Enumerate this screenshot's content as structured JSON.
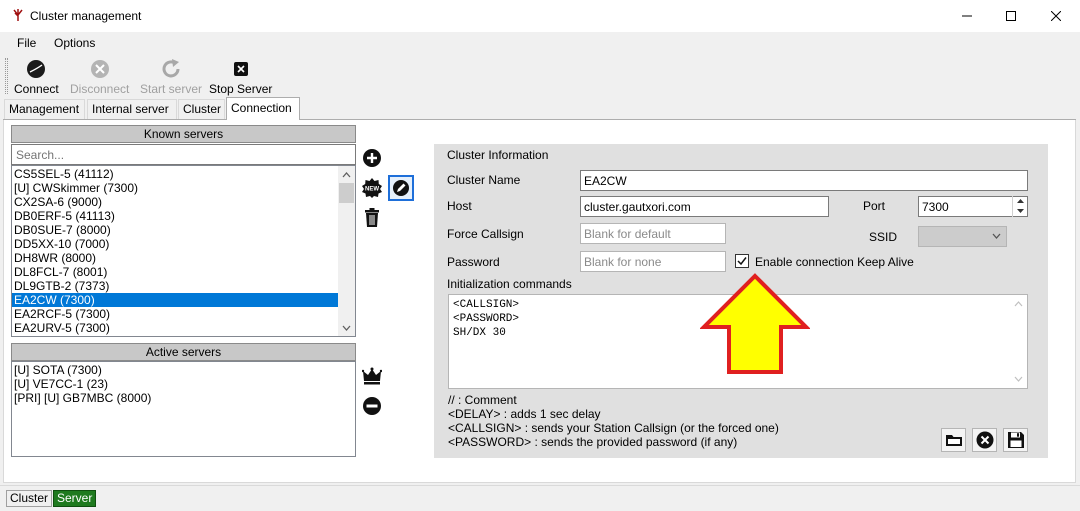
{
  "window": {
    "title": "Cluster management"
  },
  "menu": {
    "file": "File",
    "options": "Options"
  },
  "toolbar": {
    "connect": "Connect",
    "disconnect": "Disconnect",
    "start_server": "Start server",
    "stop_server": "Stop Server"
  },
  "tabs": [
    "Management",
    "Internal server",
    "Cluster",
    "Connection"
  ],
  "active_tab": "Connection",
  "known_servers": {
    "header": "Known servers",
    "search_placeholder": "Search...",
    "items": [
      "CS5SEL-5 (41112)",
      "[U] CWSkimmer (7300)",
      "CX2SA-6 (9000)",
      "DB0ERF-5 (41113)",
      "DB0SUE-7 (8000)",
      "DD5XX-10 (7000)",
      "DH8WR (8000)",
      "DL8FCL-7 (8001)",
      "DL9GTB-2 (7373)",
      "EA2CW (7300)",
      "EA2RCF-5 (7300)",
      "EA2URV-5 (7300)"
    ],
    "selected": "EA2CW (7300)"
  },
  "active_servers": {
    "header": "Active servers",
    "items": [
      "[U] SOTA (7300)",
      "[U] VE7CC-1 (23)",
      "[PRI] [U] GB7MBC (8000)"
    ]
  },
  "cluster_info": {
    "title": "Cluster Information",
    "name_label": "Cluster Name",
    "name_value": "EA2CW",
    "host_label": "Host",
    "host_value": "cluster.gautxori.com",
    "port_label": "Port",
    "port_value": "7300",
    "force_callsign_label": "Force Callsign",
    "force_callsign_placeholder": "Blank for default",
    "ssid_label": "SSID",
    "password_label": "Password",
    "password_placeholder": "Blank for none",
    "keepalive_label": "Enable connection Keep Alive",
    "keepalive_checked": true,
    "init_label": "Initialization commands",
    "init_lines": [
      "<CALLSIGN>",
      "<PASSWORD>",
      "SH/DX 30"
    ],
    "help": [
      "// : Comment",
      "<DELAY> : adds 1 sec delay",
      "<CALLSIGN> : sends your Station Callsign (or the forced one)",
      "<PASSWORD> : sends the provided password (if any)"
    ]
  },
  "status": {
    "cluster": "Cluster",
    "server": "Server"
  },
  "colors": {
    "selection": "#0078d7",
    "server_status": "#1f7a1f",
    "arrow_fill": "#ffff00",
    "arrow_stroke": "#e02020"
  }
}
